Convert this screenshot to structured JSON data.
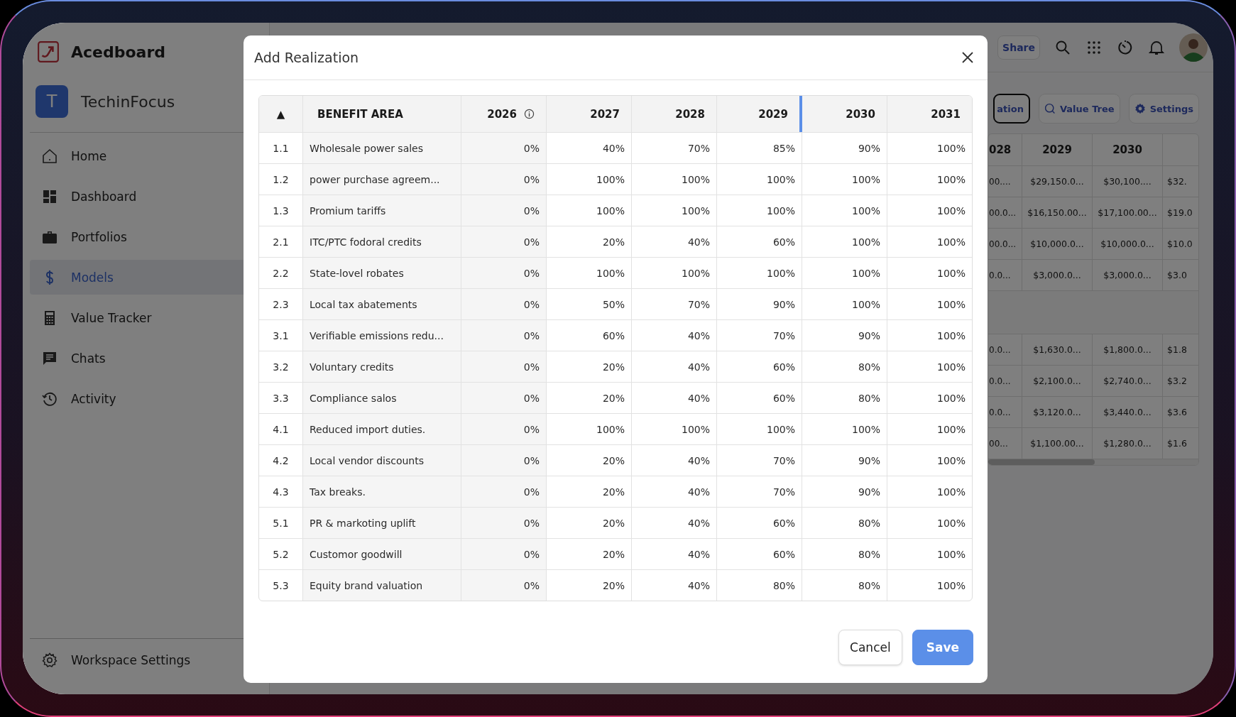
{
  "app": {
    "name": "Acedboard"
  },
  "workspace": {
    "initial": "T",
    "name": "TechinFocus"
  },
  "sidebar": {
    "items": [
      {
        "label": "Home",
        "kind": "home",
        "selected": false
      },
      {
        "label": "Dashboard",
        "kind": "dashboard",
        "selected": false
      },
      {
        "label": "Portfolios",
        "kind": "portfolios",
        "selected": false
      },
      {
        "label": "Models",
        "kind": "models",
        "selected": true
      },
      {
        "label": "Value Tracker",
        "kind": "tracker",
        "selected": false
      },
      {
        "label": "Chats",
        "kind": "chats",
        "selected": false
      },
      {
        "label": "Activity",
        "kind": "activity",
        "selected": false
      }
    ],
    "footer": {
      "label": "Workspace Settings"
    }
  },
  "top_bar": {
    "share": "Share"
  },
  "view_buttons": [
    {
      "label": "ation",
      "kind": "outlined"
    },
    {
      "label": "Value Tree",
      "kind": "tree"
    },
    {
      "label": "Settings",
      "kind": "settings"
    }
  ],
  "background_table": {
    "columns": [
      "028",
      "2029",
      "2030"
    ],
    "groups": [
      [
        [
          "00....",
          "$29,150.0...",
          "$30,100....",
          "$32."
        ],
        [
          "00.0...",
          "$16,150.00...",
          "$17,100.00...",
          "$19.0"
        ],
        [
          "00.0...",
          "$10,000.0...",
          "$10,000.0...",
          "$10.0"
        ],
        [
          "0.0...",
          "$3,000.0...",
          "$3,000.0...",
          "$3.0"
        ]
      ],
      [
        [
          "0.0...",
          "$1,630.0...",
          "$1,800.0...",
          "$1.8"
        ],
        [
          "0.0...",
          "$2,100.0...",
          "$2,740.0...",
          "$3.2"
        ],
        [
          "0.0...",
          "$3,120.0...",
          "$3,440.0...",
          "$3.6"
        ],
        [
          "00...",
          "$1,100.00...",
          "$1,280.0...",
          "$1.6"
        ]
      ]
    ]
  },
  "dialog": {
    "title": "Add Realization",
    "table": {
      "sort_indicator": "▲",
      "columns": [
        {
          "label": "BENEFIT AREA",
          "info": false,
          "resizing": false
        },
        {
          "label": "2026",
          "info": true,
          "resizing": false
        },
        {
          "label": "2027",
          "info": false,
          "resizing": false
        },
        {
          "label": "2028",
          "info": false,
          "resizing": false
        },
        {
          "label": "2029",
          "info": false,
          "resizing": true
        },
        {
          "label": "2030",
          "info": false,
          "resizing": false
        },
        {
          "label": "2031",
          "info": false,
          "resizing": false
        }
      ],
      "rows": [
        {
          "id": "1.1",
          "name": "Wholesale power sales",
          "values": [
            "0%",
            "40%",
            "70%",
            "85%",
            "90%",
            "100%"
          ]
        },
        {
          "id": "1.2",
          "name": "power purchase agreem...",
          "values": [
            "0%",
            "100%",
            "100%",
            "100%",
            "100%",
            "100%"
          ]
        },
        {
          "id": "1.3",
          "name": "Promium tariffs",
          "values": [
            "0%",
            "100%",
            "100%",
            "100%",
            "100%",
            "100%"
          ]
        },
        {
          "id": "2.1",
          "name": "ITC/PTC fodoral credits",
          "values": [
            "0%",
            "20%",
            "40%",
            "60%",
            "100%",
            "100%"
          ]
        },
        {
          "id": "2.2",
          "name": "State-lovel robates",
          "values": [
            "0%",
            "100%",
            "100%",
            "100%",
            "100%",
            "100%"
          ]
        },
        {
          "id": "2.3",
          "name": "Local tax abatements",
          "values": [
            "0%",
            "50%",
            "70%",
            "90%",
            "100%",
            "100%"
          ]
        },
        {
          "id": "3.1",
          "name": "Verifiable emissions redu...",
          "values": [
            "0%",
            "60%",
            "40%",
            "70%",
            "90%",
            "100%"
          ]
        },
        {
          "id": "3.2",
          "name": "Voluntary credits",
          "values": [
            "0%",
            "20%",
            "40%",
            "60%",
            "80%",
            "100%"
          ]
        },
        {
          "id": "3.3",
          "name": "Compliance salos",
          "values": [
            "0%",
            "20%",
            "40%",
            "60%",
            "80%",
            "100%"
          ]
        },
        {
          "id": "4.1",
          "name": "Reduced import duties.",
          "values": [
            "0%",
            "100%",
            "100%",
            "100%",
            "100%",
            "100%"
          ]
        },
        {
          "id": "4.2",
          "name": "Local vendor discounts",
          "values": [
            "0%",
            "20%",
            "40%",
            "70%",
            "90%",
            "100%"
          ]
        },
        {
          "id": "4.3",
          "name": "Tax breaks.",
          "values": [
            "0%",
            "20%",
            "40%",
            "70%",
            "90%",
            "100%"
          ]
        },
        {
          "id": "5.1",
          "name": "PR & markoting uplift",
          "values": [
            "0%",
            "20%",
            "40%",
            "60%",
            "80%",
            "100%"
          ]
        },
        {
          "id": "5.2",
          "name": "Customor goodwill",
          "values": [
            "0%",
            "20%",
            "40%",
            "60%",
            "80%",
            "100%"
          ]
        },
        {
          "id": "5.3",
          "name": "Equity brand valuation",
          "values": [
            "0%",
            "20%",
            "40%",
            "80%",
            "80%",
            "100%"
          ]
        }
      ]
    },
    "buttons": [
      {
        "label": "Cancel",
        "kind": "secondary"
      },
      {
        "label": "Save",
        "kind": "primary"
      }
    ]
  }
}
